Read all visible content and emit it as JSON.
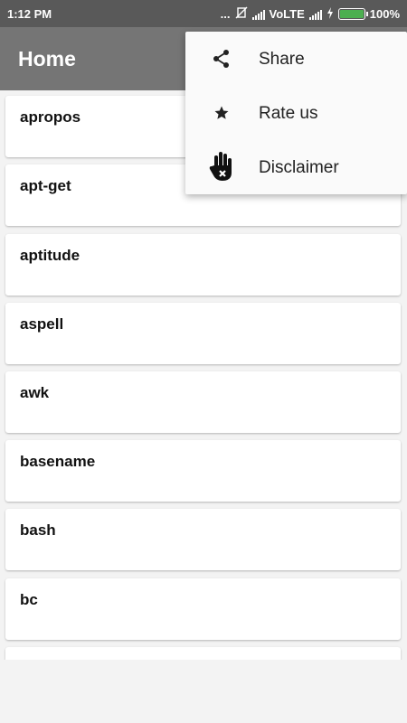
{
  "status_bar": {
    "time": "1:12 PM",
    "dots": "...",
    "network": "VoLTE",
    "battery": "100%",
    "battery_level": 1.0,
    "battery_color": "#4caf50"
  },
  "app_bar": {
    "title": "Home"
  },
  "commands": [
    "apropos",
    "apt-get",
    "aptitude",
    "aspell",
    "awk",
    "basename",
    "bash",
    "bc",
    ""
  ],
  "overflow_menu": {
    "items": [
      {
        "label": "Share",
        "icon": "share-icon"
      },
      {
        "label": "Rate us",
        "icon": "star-icon"
      },
      {
        "label": "Disclaimer",
        "icon": "hand-icon"
      }
    ]
  },
  "colors": {
    "status_bar": "#595959",
    "app_bar": "#757575",
    "background": "#f3f3f3"
  }
}
